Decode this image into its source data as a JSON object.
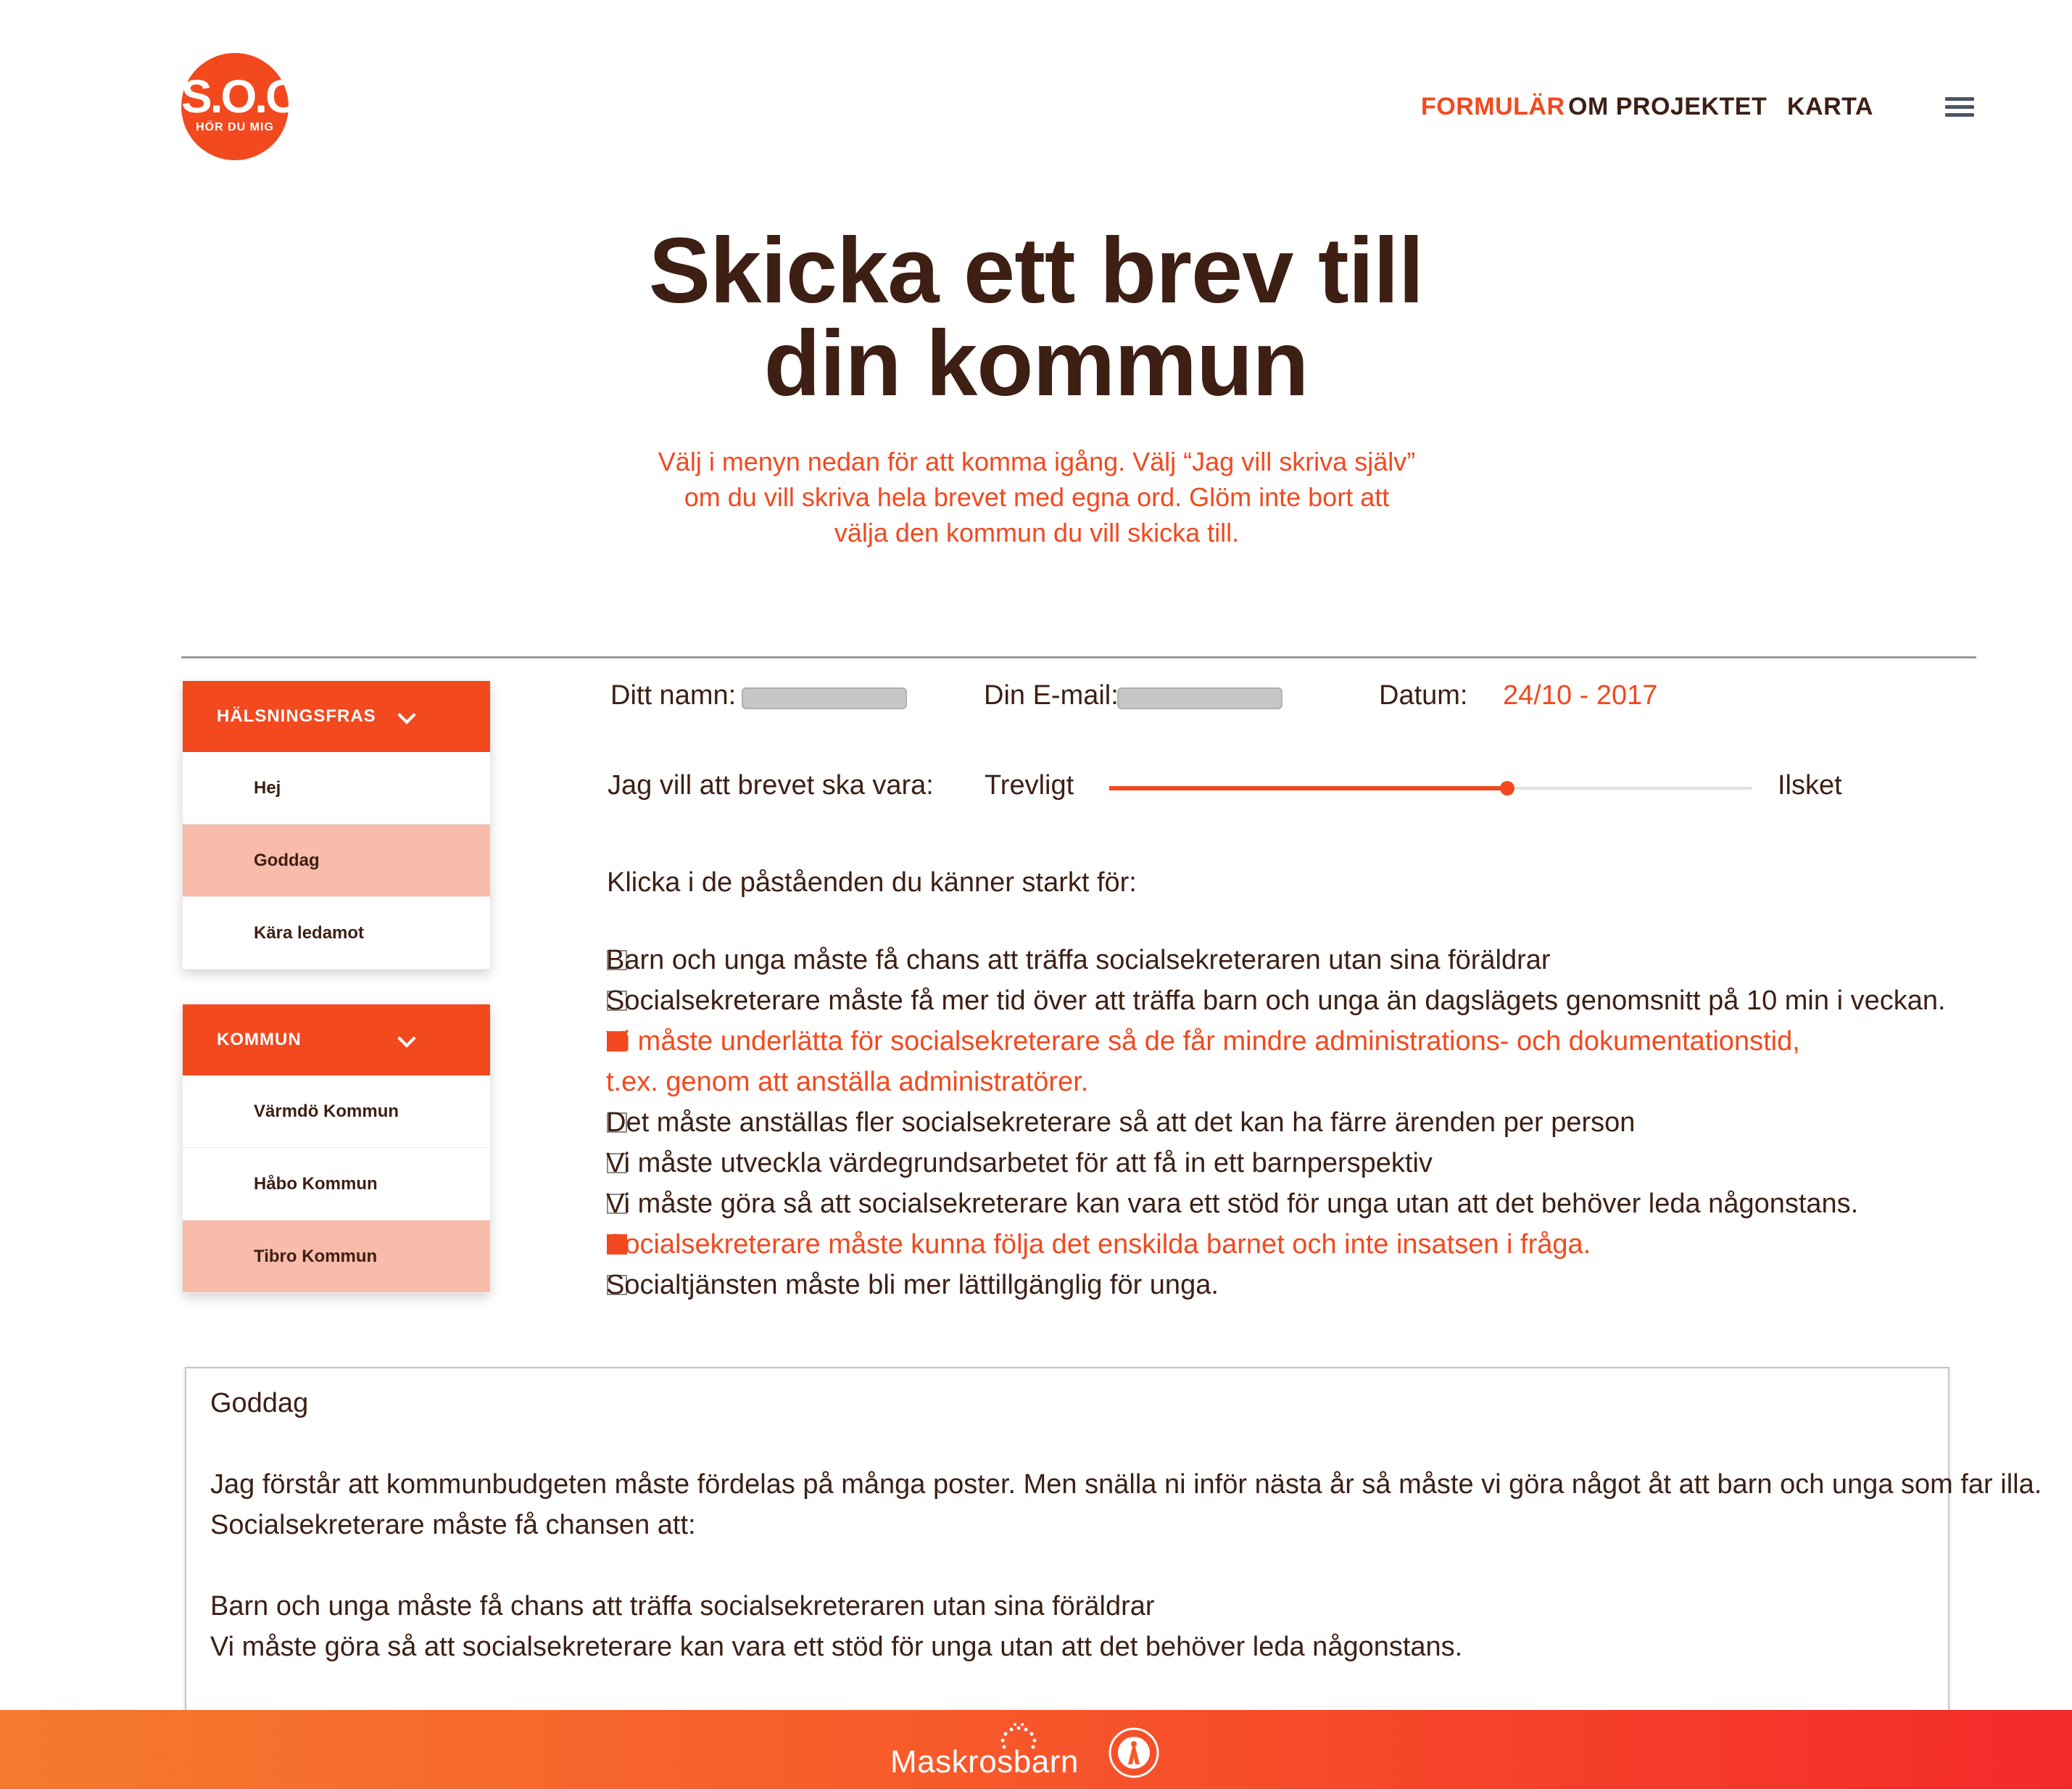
{
  "header": {
    "logo_text": "S.O.C.",
    "logo_subtext": "HÖR DU MIG",
    "nav": [
      {
        "label": "FORMULÄR",
        "active": true
      },
      {
        "label": "OM PROJEKTET",
        "active": false
      },
      {
        "label": "KARTA",
        "active": false
      }
    ],
    "menu_icon": "hamburger-menu-icon"
  },
  "hero": {
    "title_line1": "Skicka ett brev till",
    "title_line2": "din kommun",
    "subtitle_line1": "Välj i menyn nedan för att komma igång. Välj “Jag vill skriva själv”",
    "subtitle_line2": "om du vill skriva hela brevet med egna ord. Glöm inte bort att",
    "subtitle_line3": "välja den kommun du vill skicka till."
  },
  "greeting_menu": {
    "title": "HÄLSNINGSFRAS",
    "items": [
      {
        "label": "Hej",
        "selected": false
      },
      {
        "label": "Goddag",
        "selected": true
      },
      {
        "label": "Kära ledamot",
        "selected": false
      }
    ]
  },
  "kommun_menu": {
    "title": "KOMMUN",
    "items": [
      {
        "label": "Värmdö Kommun",
        "selected": false
      },
      {
        "label": "Håbo Kommun",
        "selected": false
      },
      {
        "label": "Tibro Kommun",
        "selected": true
      }
    ]
  },
  "form": {
    "name_label": "Ditt namn:",
    "name_value": "",
    "email_label": "Din E-mail:",
    "email_value": "",
    "date_label": "Datum:",
    "date_value": "24/10 - 2017",
    "tone_label": "Jag vill att brevet ska vara:",
    "tone_min": "Trevligt",
    "tone_max": "Ilsket",
    "tone_value": 0.62,
    "statements_label": "Klicka i de påståenden du känner starkt för:",
    "statements": [
      {
        "text": "Barn och unga måste få chans att träffa socialsekreteraren utan sina föräldrar",
        "checked": false
      },
      {
        "text": "Socialsekreterare måste få mer tid över att träffa barn och unga än dagslägets genomsnitt på 10 min i veckan.",
        "checked": false
      },
      {
        "text": "Vi måste underlätta för socialsekreterare så de får mindre administrations- och dokumentationstid,",
        "text2": "t.ex. genom att anställa administratörer.",
        "checked": true
      },
      {
        "text": "Det måste anställas fler socialsekreterare så att det kan ha färre ärenden per person",
        "checked": false
      },
      {
        "text": "Vi måste utveckla värdegrundsarbetet för att få in ett barnperspektiv",
        "checked": false
      },
      {
        "text": "Vi måste göra så att socialsekreterare kan vara ett stöd för unga utan att det behöver leda någonstans.",
        "checked": false
      },
      {
        "text": "Socialsekreterare måste kunna följa det enskilda barnet och inte insatsen i fråga.",
        "checked": true
      },
      {
        "text": "Socialtjänsten måste bli mer lättillgänglig för unga.",
        "checked": false
      }
    ]
  },
  "letter": {
    "greeting": "Goddag",
    "para1_line1": "Jag förstår att kommunbudgeten måste fördelas på många poster. Men snälla ni inför nästa år så måste vi göra något åt att barn och unga som far illa.",
    "para1_line2": "Socialsekreterare måste få chansen att:",
    "point1": "Barn och unga måste få chans att träffa socialsekreteraren utan sina föräldrar",
    "point2": "Vi måste göra så att socialsekreterare kan vara ett stöd för unga utan att det behöver leda någonstans."
  },
  "footer": {
    "logo_text": "Maskrosbarn",
    "icons": [
      "dandelion-icon",
      "seal-icon"
    ]
  },
  "colors": {
    "accent": "#f2491f",
    "text": "#3d1f14",
    "selected_bg": "#f9bbaa"
  }
}
